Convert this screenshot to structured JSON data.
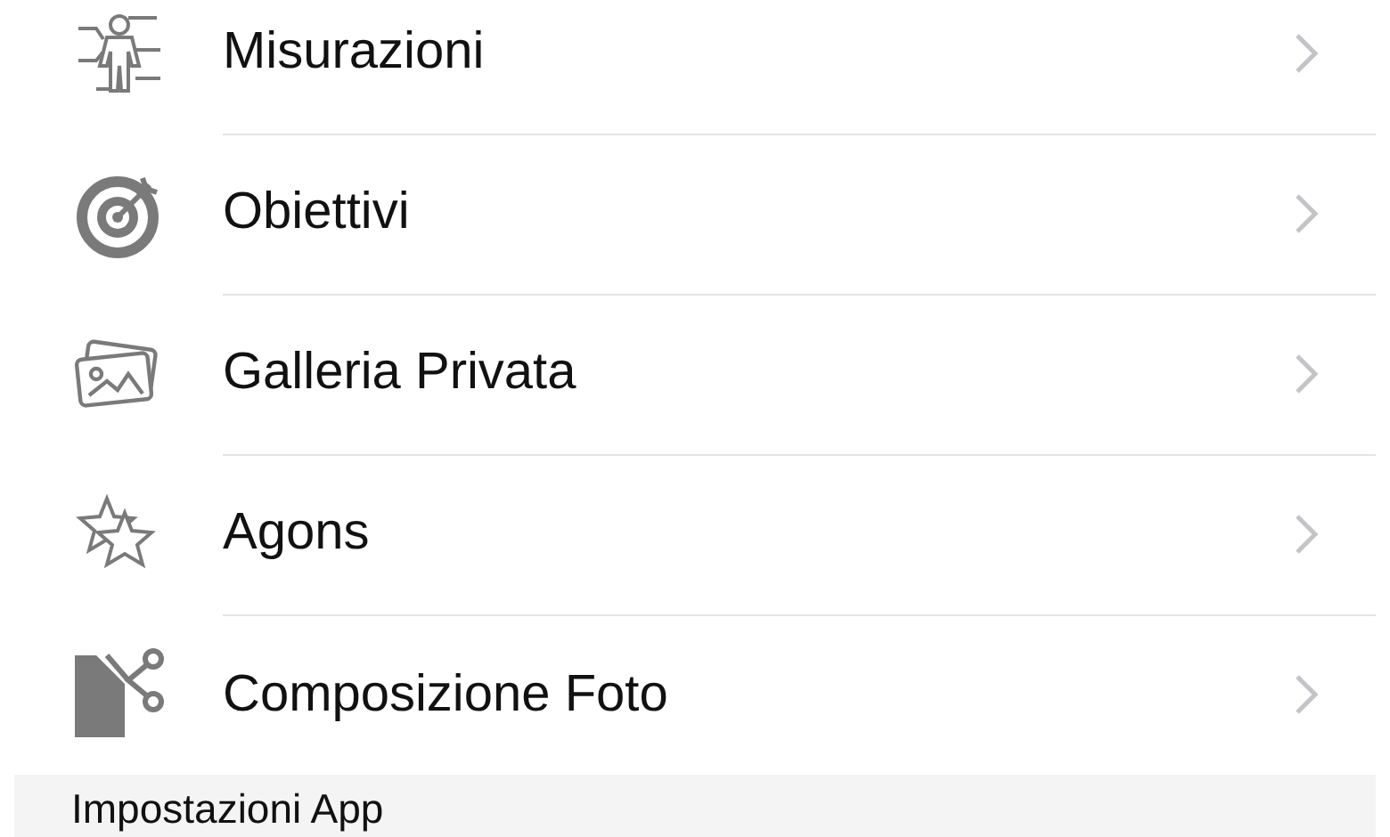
{
  "menu_items": [
    {
      "kind": "body",
      "label": "Misurazioni"
    },
    {
      "kind": "target",
      "label": "Obiettivi"
    },
    {
      "kind": "photos",
      "label": "Galleria Privata"
    },
    {
      "kind": "stars",
      "label": "Agons"
    },
    {
      "kind": "collage",
      "label": "Composizione Foto"
    }
  ],
  "section_header": {
    "title": "Impostazioni App"
  }
}
